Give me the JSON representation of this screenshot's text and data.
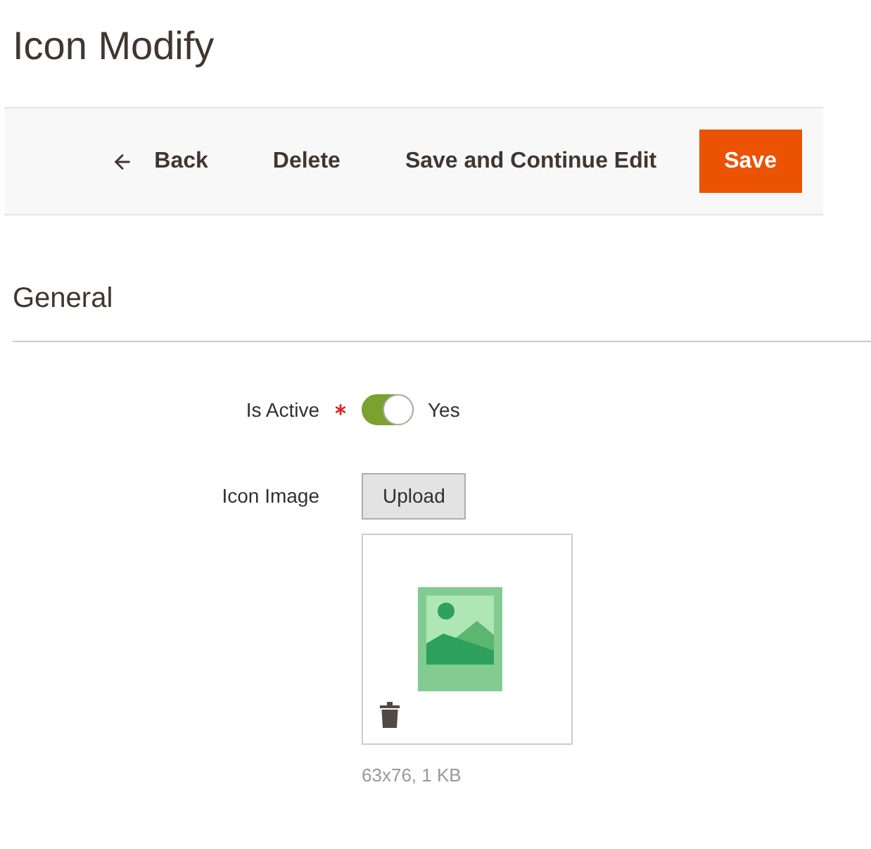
{
  "page": {
    "title": "Icon Modify"
  },
  "toolbar": {
    "buttons": [
      {
        "kind": "back",
        "label": "Back"
      },
      {
        "kind": "text",
        "label": "Delete"
      },
      {
        "kind": "text",
        "label": "Save and Continue Edit"
      },
      {
        "kind": "primary",
        "label": "Save"
      }
    ]
  },
  "section": {
    "title": "General"
  },
  "fields": [
    {
      "kind": "toggle",
      "label": "Is Active",
      "required": true,
      "on": true,
      "value_label": "Yes"
    },
    {
      "kind": "image",
      "label": "Icon Image",
      "required": false,
      "button": "Upload",
      "file_info": "63x76, 1 KB"
    }
  ]
}
